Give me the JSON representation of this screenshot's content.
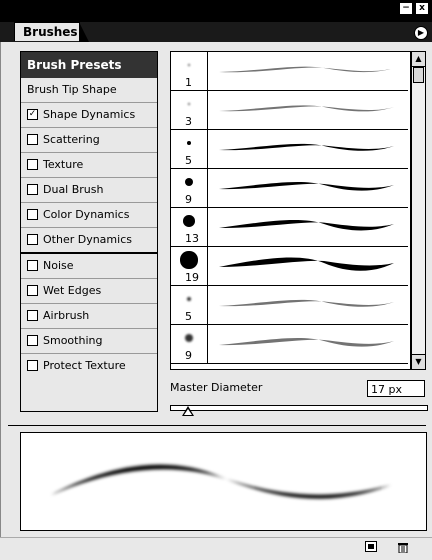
{
  "window": {
    "title": "Brushes",
    "minimize_glyph": "−",
    "close_glyph": "x",
    "menu_glyph": "▶"
  },
  "options": {
    "header": "Brush Presets",
    "items": [
      {
        "label": "Brush Tip Shape",
        "has_checkbox": false,
        "checked": false
      },
      {
        "label": "Shape Dynamics",
        "has_checkbox": true,
        "checked": true
      },
      {
        "label": "Scattering",
        "has_checkbox": true,
        "checked": false
      },
      {
        "label": "Texture",
        "has_checkbox": true,
        "checked": false
      },
      {
        "label": "Dual Brush",
        "has_checkbox": true,
        "checked": false
      },
      {
        "label": "Color Dynamics",
        "has_checkbox": true,
        "checked": false
      },
      {
        "label": "Other Dynamics",
        "has_checkbox": true,
        "checked": false
      },
      {
        "label": "Noise",
        "has_checkbox": true,
        "checked": false
      },
      {
        "label": "Wet Edges",
        "has_checkbox": true,
        "checked": false
      },
      {
        "label": "Airbrush",
        "has_checkbox": true,
        "checked": false
      },
      {
        "label": "Smoothing",
        "has_checkbox": true,
        "checked": false
      },
      {
        "label": "Protect Texture",
        "has_checkbox": true,
        "checked": false
      }
    ]
  },
  "presets": [
    {
      "size": "1",
      "hardness": "soft"
    },
    {
      "size": "3",
      "hardness": "soft"
    },
    {
      "size": "5",
      "hardness": "hard"
    },
    {
      "size": "9",
      "hardness": "hard"
    },
    {
      "size": "13",
      "hardness": "hard"
    },
    {
      "size": "19",
      "hardness": "hard"
    },
    {
      "size": "5",
      "hardness": "soft"
    },
    {
      "size": "9",
      "hardness": "soft"
    }
  ],
  "master_diameter": {
    "label": "Master Diameter",
    "value": "17 px"
  },
  "icons": {
    "scroll_up": "▲",
    "scroll_down": "▼",
    "new_brush": "new-brush-icon",
    "delete_brush": "trash-icon"
  }
}
